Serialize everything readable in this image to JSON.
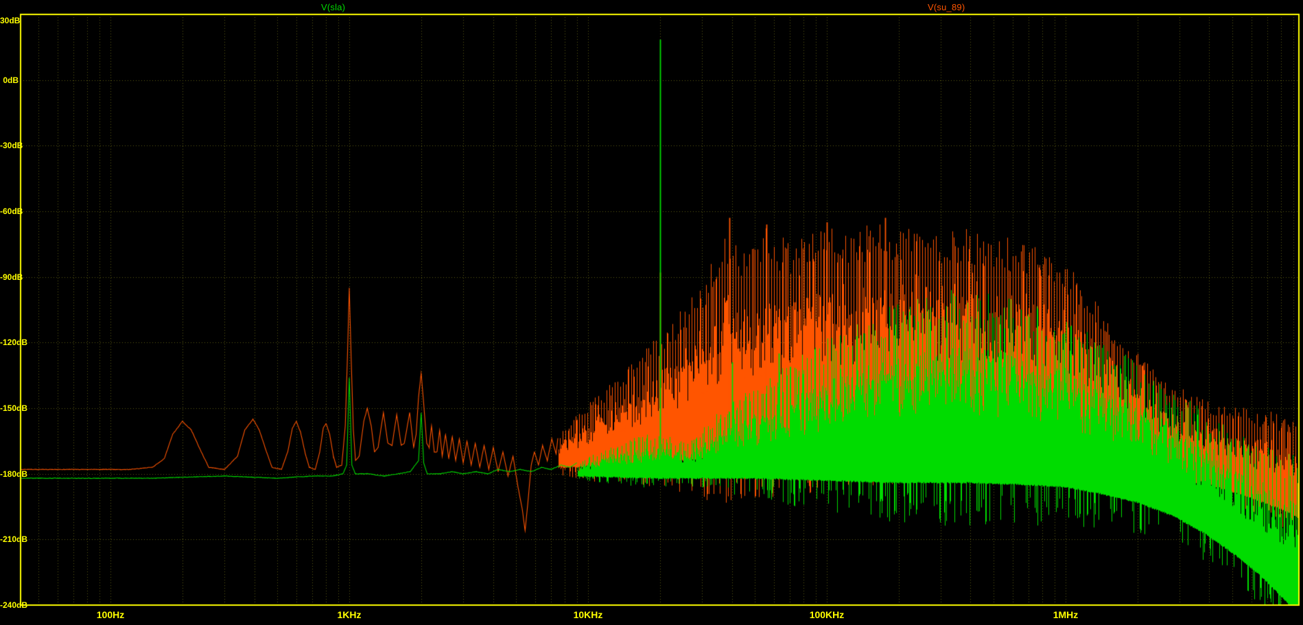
{
  "chart_data": {
    "type": "line",
    "title": "",
    "subtitle": "",
    "legend_position": "top",
    "background": "#000000",
    "grid": true,
    "style": {
      "grid_color": "#5f5f12",
      "frame_color": "#ffff00",
      "tick_label_color": "#ffff00"
    },
    "x_axis": {
      "scale": "log",
      "unit": "Hz",
      "min_hz": 42,
      "max_hz": 9490000,
      "ticks": [
        {
          "label": "100Hz",
          "hz": 100
        },
        {
          "label": "1KHz",
          "hz": 1000
        },
        {
          "label": "10KHz",
          "hz": 10000
        },
        {
          "label": "100KHz",
          "hz": 100000
        },
        {
          "label": "1MHz",
          "hz": 1000000
        }
      ]
    },
    "y_axis": {
      "unit": "dB",
      "min": -240,
      "max": 30,
      "step": 30,
      "ticks": [
        {
          "label": "30dB",
          "db": 30
        },
        {
          "label": "0dB",
          "db": 0
        },
        {
          "label": "-30dB",
          "db": -30
        },
        {
          "label": "-60dB",
          "db": -60
        },
        {
          "label": "-90dB",
          "db": -90
        },
        {
          "label": "-120dB",
          "db": -120
        },
        {
          "label": "-150dB",
          "db": -150
        },
        {
          "label": "-180dB",
          "db": -180
        },
        {
          "label": "-210dB",
          "db": -210
        },
        {
          "label": "-240dB",
          "db": -240
        }
      ]
    },
    "series": [
      {
        "name": "V(sla)",
        "color": "#00dc00",
        "line_env": [
          [
            42,
            -182
          ],
          [
            150,
            -182
          ],
          [
            300,
            -181
          ],
          [
            500,
            -182
          ],
          [
            700,
            -181
          ],
          [
            850,
            -181
          ],
          [
            940,
            -180
          ],
          [
            975,
            -176
          ],
          [
            1000,
            -136
          ],
          [
            1025,
            -176
          ],
          [
            1060,
            -180
          ],
          [
            1200,
            -180
          ],
          [
            1400,
            -181
          ],
          [
            1600,
            -180
          ],
          [
            1800,
            -179
          ],
          [
            1950,
            -174
          ],
          [
            2000,
            -152
          ],
          [
            2050,
            -175
          ],
          [
            2120,
            -180
          ],
          [
            2400,
            -180
          ],
          [
            2700,
            -179
          ],
          [
            3000,
            -180
          ],
          [
            3400,
            -179
          ],
          [
            3800,
            -180
          ],
          [
            4200,
            -178
          ],
          [
            4700,
            -179
          ],
          [
            5200,
            -178
          ],
          [
            5800,
            -179
          ],
          [
            6400,
            -177
          ],
          [
            7000,
            -178
          ],
          [
            7700,
            -176
          ],
          [
            8400,
            -177
          ],
          [
            9000,
            -175
          ]
        ],
        "band": {
          "f_start": 9000,
          "spike_period": 6,
          "env_hi": [
            [
              9000,
              -175
            ],
            [
              11000,
              -170
            ],
            [
              13000,
              -167
            ],
            [
              15000,
              -164
            ],
            [
              17500,
              -162
            ],
            [
              20000,
              -161
            ],
            [
              23000,
              -164
            ],
            [
              26000,
              -164
            ],
            [
              30000,
              -159
            ],
            [
              35000,
              -152
            ],
            [
              40000,
              -147
            ],
            [
              47000,
              -142
            ],
            [
              55000,
              -137
            ],
            [
              65000,
              -131
            ],
            [
              78000,
              -126
            ],
            [
              95000,
              -120
            ],
            [
              115000,
              -114
            ],
            [
              140000,
              -109
            ],
            [
              170000,
              -105
            ],
            [
              210000,
              -101
            ],
            [
              260000,
              -98
            ],
            [
              330000,
              -96
            ],
            [
              420000,
              -96
            ],
            [
              530000,
              -98
            ],
            [
              670000,
              -101
            ],
            [
              830000,
              -105
            ],
            [
              1000000,
              -109
            ],
            [
              1250000,
              -115
            ],
            [
              1550000,
              -121
            ],
            [
              1900000,
              -127
            ],
            [
              2350000,
              -134
            ],
            [
              2900000,
              -141
            ],
            [
              3600000,
              -149
            ],
            [
              4400000,
              -156
            ],
            [
              5400000,
              -162
            ],
            [
              6600000,
              -167
            ],
            [
              8000000,
              -170
            ],
            [
              9490000,
              -172
            ]
          ],
          "env_lo": [
            [
              9000,
              -181
            ],
            [
              20000,
              -182
            ],
            [
              50000,
              -182
            ],
            [
              100000,
              -183
            ],
            [
              200000,
              -184
            ],
            [
              400000,
              -184
            ],
            [
              700000,
              -185
            ],
            [
              1000000,
              -186
            ],
            [
              1400000,
              -189
            ],
            [
              2000000,
              -193
            ],
            [
              2800000,
              -199
            ],
            [
              3800000,
              -207
            ],
            [
              5000000,
              -216
            ],
            [
              6500000,
              -226
            ],
            [
              8000000,
              -236
            ],
            [
              9490000,
              -244
            ]
          ]
        },
        "peaks": [
          [
            20000,
            18.5,
            -181
          ],
          [
            40000,
            -129,
            -182
          ],
          [
            63000,
            -125,
            -182
          ]
        ]
      },
      {
        "name": "V(su_89)",
        "color": "#ff5500",
        "line_env": [
          [
            42,
            -178
          ],
          [
            120,
            -178
          ],
          [
            150,
            -177
          ],
          [
            168,
            -173
          ],
          [
            182,
            -162
          ],
          [
            200,
            -156
          ],
          [
            218,
            -160
          ],
          [
            240,
            -170
          ],
          [
            258,
            -177
          ],
          [
            300,
            -178
          ],
          [
            340,
            -172
          ],
          [
            365,
            -160
          ],
          [
            395,
            -155
          ],
          [
            420,
            -160
          ],
          [
            450,
            -170
          ],
          [
            475,
            -177
          ],
          [
            520,
            -178
          ],
          [
            552,
            -170
          ],
          [
            578,
            -159
          ],
          [
            600,
            -156
          ],
          [
            625,
            -161
          ],
          [
            655,
            -171
          ],
          [
            680,
            -177
          ],
          [
            720,
            -178
          ],
          [
            752,
            -170
          ],
          [
            778,
            -159
          ],
          [
            800,
            -157
          ],
          [
            828,
            -162
          ],
          [
            858,
            -172
          ],
          [
            885,
            -177
          ],
          [
            930,
            -176
          ],
          [
            962,
            -158
          ],
          [
            980,
            -130
          ],
          [
            1000,
            -95
          ],
          [
            1020,
            -130
          ],
          [
            1040,
            -160
          ],
          [
            1062,
            -174
          ],
          [
            1100,
            -172
          ],
          [
            1150,
            -156
          ],
          [
            1190,
            -150
          ],
          [
            1235,
            -158
          ],
          [
            1275,
            -170
          ],
          [
            1320,
            -168
          ],
          [
            1390,
            -152
          ],
          [
            1450,
            -166
          ],
          [
            1510,
            -167
          ],
          [
            1580,
            -153
          ],
          [
            1650,
            -167
          ],
          [
            1700,
            -166
          ],
          [
            1790,
            -152
          ],
          [
            1860,
            -168
          ],
          [
            1905,
            -162
          ],
          [
            1950,
            -145
          ],
          [
            2000,
            -134
          ],
          [
            2050,
            -148
          ],
          [
            2110,
            -166
          ],
          [
            2160,
            -168
          ],
          [
            2210,
            -158
          ],
          [
            2270,
            -170
          ],
          [
            2330,
            -170
          ],
          [
            2390,
            -160
          ],
          [
            2450,
            -172
          ],
          [
            2530,
            -162
          ],
          [
            2610,
            -173
          ],
          [
            2700,
            -163
          ],
          [
            2790,
            -174
          ],
          [
            2890,
            -164
          ],
          [
            3000,
            -175
          ],
          [
            3110,
            -165
          ],
          [
            3240,
            -176
          ],
          [
            3370,
            -166
          ],
          [
            3520,
            -177
          ],
          [
            3670,
            -167
          ],
          [
            3840,
            -178
          ],
          [
            4010,
            -168
          ],
          [
            4200,
            -179
          ],
          [
            4400,
            -170
          ],
          [
            4620,
            -181
          ],
          [
            4850,
            -172
          ],
          [
            5090,
            -186
          ],
          [
            5300,
            -196
          ],
          [
            5450,
            -206
          ],
          [
            5600,
            -193
          ],
          [
            5780,
            -176
          ],
          [
            5960,
            -170
          ],
          [
            6200,
            -176
          ],
          [
            6450,
            -167
          ],
          [
            6750,
            -174
          ],
          [
            7050,
            -164
          ],
          [
            7350,
            -171
          ],
          [
            7500,
            -162
          ]
        ],
        "band": {
          "f_start": 7500,
          "spike_period": 4,
          "env_hi": [
            [
              7500,
              -162
            ],
            [
              8300,
              -157
            ],
            [
              9200,
              -152
            ],
            [
              10500,
              -146
            ],
            [
              12000,
              -140
            ],
            [
              14000,
              -133
            ],
            [
              16500,
              -126
            ],
            [
              19000,
              -118
            ],
            [
              22000,
              -110
            ],
            [
              25500,
              -102
            ],
            [
              29000,
              -93
            ],
            [
              33000,
              -83
            ],
            [
              36500,
              -73
            ],
            [
              39000,
              -64
            ],
            [
              42000,
              -72
            ],
            [
              46000,
              -74
            ],
            [
              50000,
              -76
            ],
            [
              56000,
              -67
            ],
            [
              61000,
              -73
            ],
            [
              67000,
              -70
            ],
            [
              75000,
              -73
            ],
            [
              85000,
              -69
            ],
            [
              100000,
              -66
            ],
            [
              120000,
              -68
            ],
            [
              145000,
              -66
            ],
            [
              175000,
              -64
            ],
            [
              215000,
              -66
            ],
            [
              260000,
              -65
            ],
            [
              320000,
              -67
            ],
            [
              400000,
              -68
            ],
            [
              500000,
              -70
            ],
            [
              620000,
              -72
            ],
            [
              760000,
              -75
            ],
            [
              900000,
              -79
            ],
            [
              1050000,
              -85
            ],
            [
              1200000,
              -93
            ],
            [
              1400000,
              -103
            ],
            [
              1650000,
              -113
            ],
            [
              1950000,
              -123
            ],
            [
              2300000,
              -131
            ],
            [
              2700000,
              -138
            ],
            [
              3200000,
              -142
            ],
            [
              3800000,
              -145
            ],
            [
              4500000,
              -149
            ],
            [
              5300000,
              -148
            ],
            [
              6200000,
              -152
            ],
            [
              7300000,
              -151
            ],
            [
              8400000,
              -155
            ],
            [
              9490000,
              -157
            ]
          ],
          "env_lo": [
            [
              7500,
              -177
            ],
            [
              15000,
              -176
            ],
            [
              30000,
              -173
            ],
            [
              60000,
              -169
            ],
            [
              100000,
              -166
            ],
            [
              200000,
              -163
            ],
            [
              400000,
              -161
            ],
            [
              700000,
              -161
            ],
            [
              1000000,
              -163
            ],
            [
              1400000,
              -167
            ],
            [
              2000000,
              -172
            ],
            [
              3000000,
              -179
            ],
            [
              4300000,
              -186
            ],
            [
              6000000,
              -191
            ],
            [
              8000000,
              -196
            ],
            [
              9490000,
              -200
            ]
          ]
        },
        "peaks": [
          [
            20000,
            -88,
            -175
          ],
          [
            39000,
            -63,
            -172
          ],
          [
            56000,
            -66,
            -170
          ],
          [
            100000,
            -65,
            -166
          ],
          [
            175000,
            -63,
            -164
          ]
        ]
      }
    ]
  }
}
